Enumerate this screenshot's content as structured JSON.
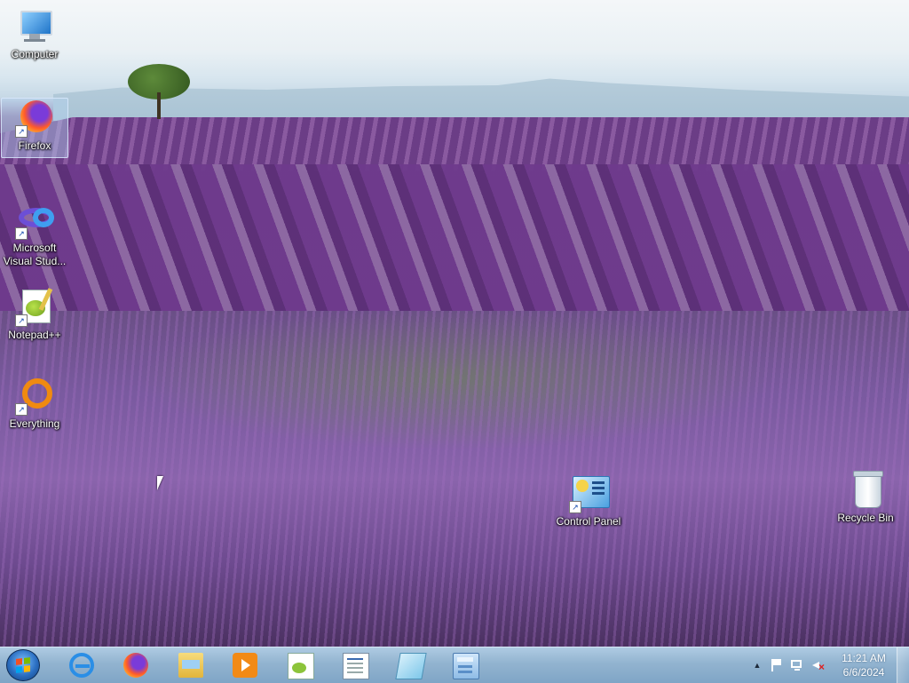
{
  "desktop": {
    "icons": [
      {
        "id": "computer",
        "label": "Computer",
        "icon": "computer-icon"
      },
      {
        "id": "firefox",
        "label": "Firefox",
        "icon": "firefox-icon",
        "shortcut": true,
        "selected": true
      },
      {
        "id": "vs",
        "label": "Microsoft Visual Stud...",
        "icon": "visual-studio-icon",
        "shortcut": true
      },
      {
        "id": "notepadpp",
        "label": "Notepad++",
        "icon": "notepad-plus-plus-icon",
        "shortcut": true
      },
      {
        "id": "everything",
        "label": "Everything",
        "icon": "everything-search-icon",
        "shortcut": true
      },
      {
        "id": "control_panel",
        "label": "Control Panel",
        "icon": "control-panel-icon",
        "shortcut": true
      },
      {
        "id": "recycle_bin",
        "label": "Recycle Bin",
        "icon": "recycle-bin-icon"
      }
    ],
    "vs_label_line1": "Microsoft",
    "vs_label_line2": "Visual Stud..."
  },
  "taskbar": {
    "start_icon": "windows-start-icon",
    "pinned": [
      {
        "name": "Internet Explorer",
        "icon": "internet-explorer-icon"
      },
      {
        "name": "Firefox",
        "icon": "firefox-icon"
      },
      {
        "name": "Windows Explorer",
        "icon": "file-explorer-icon"
      },
      {
        "name": "Windows Media Player",
        "icon": "media-player-icon"
      },
      {
        "name": "Notepad++",
        "icon": "notepad-plus-plus-icon"
      },
      {
        "name": "WordPad",
        "icon": "wordpad-icon"
      },
      {
        "name": "Sticky Notes",
        "icon": "sticky-notes-icon"
      },
      {
        "name": "Calculator",
        "icon": "calculator-icon"
      }
    ],
    "tray": {
      "show_hidden_icon": "▲",
      "action_center_icon": "flag-icon",
      "network_icon": "network-icon",
      "volume_icon": "volume-muted-icon"
    },
    "clock": {
      "time": "11:21 AM",
      "date": "6/6/2024"
    }
  }
}
